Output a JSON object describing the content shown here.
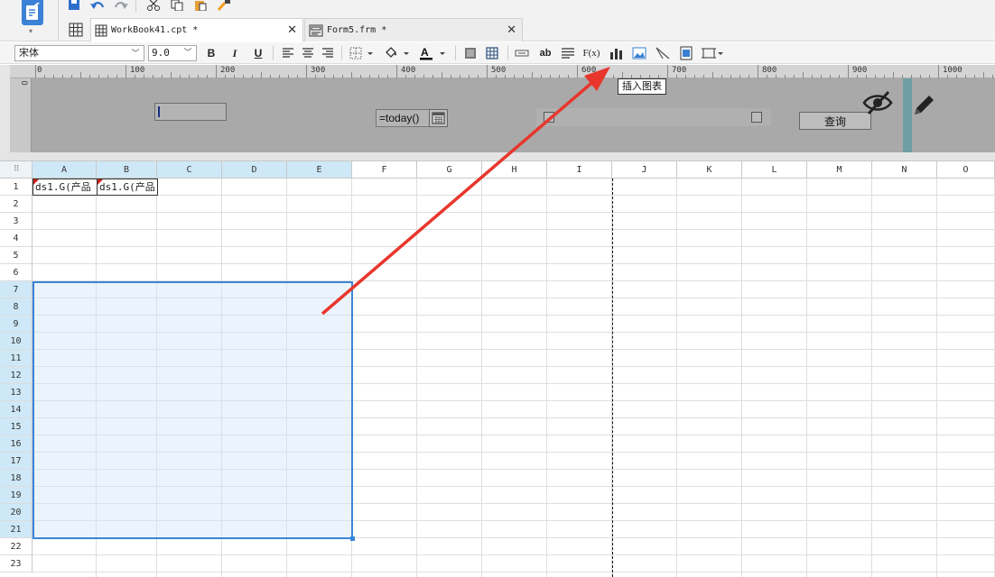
{
  "tabs": [
    {
      "label": "WorkBook41.cpt *"
    },
    {
      "label": "Form5.frm *"
    }
  ],
  "toolbar": {
    "font_family": "宋体",
    "font_size": "9.0",
    "bold_label": "B",
    "italic_label": "I",
    "underline_label": "U",
    "text_tool_label": "ab",
    "formula_label": "F(x)",
    "text_color": "#111111",
    "underline_accent": "#1e5bd8"
  },
  "ruler": {
    "labels": [
      "0",
      "100",
      "200",
      "300",
      "400",
      "500",
      "600",
      "700",
      "800",
      "900",
      "1000"
    ]
  },
  "param_panel": {
    "date_formula": "=today()",
    "query_label": "查询"
  },
  "tooltip": {
    "text": "插入图表"
  },
  "sheet": {
    "columns": [
      "A",
      "B",
      "C",
      "D",
      "E",
      "F",
      "G",
      "H",
      "I",
      "J",
      "K",
      "L",
      "M",
      "N",
      "O"
    ],
    "rows": [
      "1",
      "2",
      "3",
      "4",
      "5",
      "6",
      "7",
      "8",
      "9",
      "10",
      "11",
      "12",
      "13",
      "14",
      "15",
      "16",
      "17",
      "18",
      "19",
      "20",
      "21",
      "22",
      "23"
    ],
    "cells": [
      {
        "ref": "A1",
        "value": "ds1.G(产品"
      },
      {
        "ref": "B1",
        "value": "ds1.G(产品"
      }
    ],
    "selection_range": "A7:E21",
    "selection_color": "#3a86d8"
  },
  "annotation": {
    "arrow_color": "#e8362c"
  }
}
